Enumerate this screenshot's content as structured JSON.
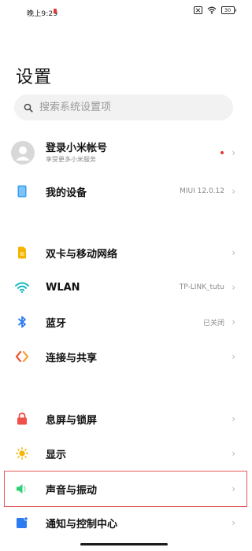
{
  "status_bar": {
    "time": "晚上9:29",
    "battery": "30"
  },
  "page": {
    "title": "设置"
  },
  "search": {
    "placeholder": "搜索系统设置项"
  },
  "account": {
    "title": "登录小米帐号",
    "subtitle": "享受更多小米服务"
  },
  "device": {
    "label": "我的设备",
    "value": "MIUI 12.0.12"
  },
  "network": [
    {
      "label": "双卡与移动网络",
      "value": "",
      "icon": "sim-card-icon",
      "color": "#f5b400"
    },
    {
      "label": "WLAN",
      "value": "TP-LINK_tutu",
      "icon": "wifi-icon",
      "color": "#16b8c4"
    },
    {
      "label": "蓝牙",
      "value": "已关闭",
      "icon": "bluetooth-icon",
      "color": "#2d7bf0"
    },
    {
      "label": "连接与共享",
      "value": "",
      "icon": "connection-sharing-icon",
      "color": "#f2572f"
    }
  ],
  "personal": [
    {
      "label": "息屏与锁屏",
      "value": "",
      "icon": "lock-icon",
      "color": "#f0504a"
    },
    {
      "label": "显示",
      "value": "",
      "icon": "sun-icon",
      "color": "#f5b400"
    },
    {
      "label": "声音与振动",
      "value": "",
      "icon": "speaker-icon",
      "color": "#2fcf74"
    },
    {
      "label": "通知与控制中心",
      "value": "",
      "icon": "notification-icon",
      "color": "#2d7bf0"
    }
  ],
  "chevron": "›",
  "colors": {
    "highlight": "#e05a5a",
    "account_dot": "#e53935",
    "device_icon": "#3aa0f0"
  }
}
